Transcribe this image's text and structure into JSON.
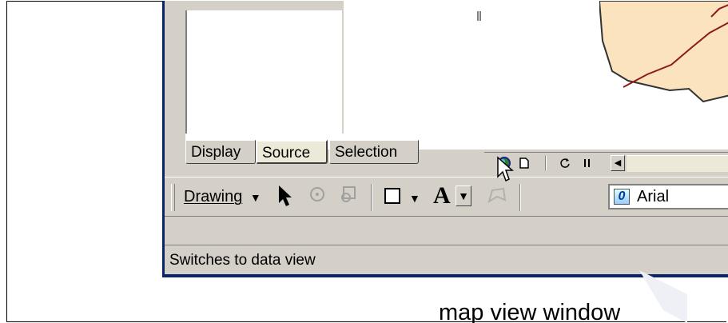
{
  "tabs": {
    "display": "Display",
    "source": "Source",
    "selection": "Selection"
  },
  "view_buttons": {
    "data_view_icon": "globe-icon",
    "layout_view_icon": "page-icon",
    "refresh_icon": "refresh-icon",
    "pause_icon": "pause-icon",
    "scroll_left": "◀"
  },
  "toolbar": {
    "drawing_label": "Drawing",
    "font_name": "Arial",
    "font_icon_letter": "0",
    "text_tool_letter": "A"
  },
  "statusbar": {
    "text": "Switches to data view"
  },
  "caption": {
    "text": "map view window"
  },
  "colors": {
    "window_face": "#d4d0c8",
    "window_border": "#0a246a",
    "map_fill": "#fbe3bd",
    "map_line": "#8b1a1a"
  }
}
